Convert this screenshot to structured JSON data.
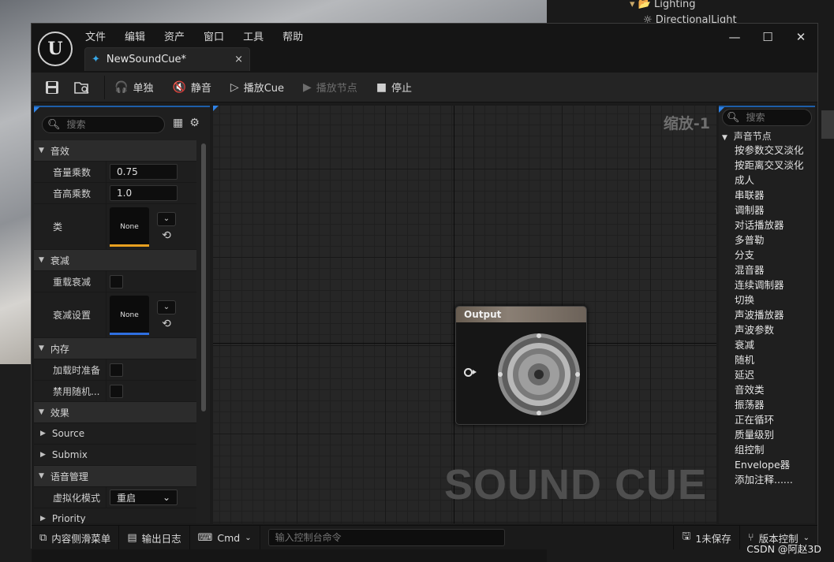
{
  "background": {
    "outliner_rows": [
      {
        "label": "Lighting"
      },
      {
        "label": "DirectionalLight"
      }
    ]
  },
  "window": {
    "menu": [
      "文件",
      "编辑",
      "资产",
      "窗口",
      "工具",
      "帮助"
    ],
    "tab": {
      "label": "NewSoundCue*",
      "close": "×"
    },
    "controls": {
      "minimize": "—",
      "maximize": "☐",
      "close": "✕"
    }
  },
  "toolbar": {
    "solo": "单独",
    "mute": "静音",
    "play_cue": "播放Cue",
    "play_node": "播放节点",
    "stop": "停止"
  },
  "details": {
    "search_placeholder": "搜索",
    "sections": {
      "sound": "音效",
      "attenuation": "衰减",
      "memory": "内存",
      "effects": "效果",
      "source": "Source",
      "submix": "Submix",
      "voice_mgmt": "语音管理",
      "priority": "Priority"
    },
    "props": {
      "volume_label": "音量乘数",
      "volume_value": "0.75",
      "pitch_label": "音高乘数",
      "pitch_value": "1.0",
      "class_label": "类",
      "class_value": "None",
      "override_att_label": "重载衰减",
      "att_settings_label": "衰减设置",
      "att_settings_value": "None",
      "preload_label": "加载时准备",
      "disable_random_label": "禁用随机...",
      "virtual_mode_label": "虚拟化模式",
      "virtual_mode_value": "重启"
    },
    "colors": {
      "class_stripe": "#e8a020",
      "attenuation_stripe": "#2f6fe0"
    }
  },
  "graph": {
    "zoom": "缩放-1",
    "watermark": "SOUND CUE",
    "output_node": {
      "title": "Output"
    }
  },
  "palette": {
    "search_placeholder": "搜索",
    "category": "声音节点",
    "items": [
      "按参数交叉淡化",
      "按距离交叉淡化",
      "成人",
      "串联器",
      "调制器",
      "对话播放器",
      "多普勒",
      "分支",
      "混音器",
      "连续调制器",
      "切换",
      "声波播放器",
      "声波参数",
      "衰减",
      "随机",
      "延迟",
      "音效类",
      "振荡器",
      "正在循环",
      "质量级别",
      "组控制",
      "Envelope器",
      "添加注释......"
    ]
  },
  "statusbar": {
    "content_drawer": "内容侧滑菜单",
    "output_log": "输出日志",
    "cmd": "Cmd",
    "console_placeholder": "输入控制台命令",
    "unsaved": "1未保存",
    "source_control": "版本控制"
  },
  "credit": "CSDN @阿赵3D"
}
